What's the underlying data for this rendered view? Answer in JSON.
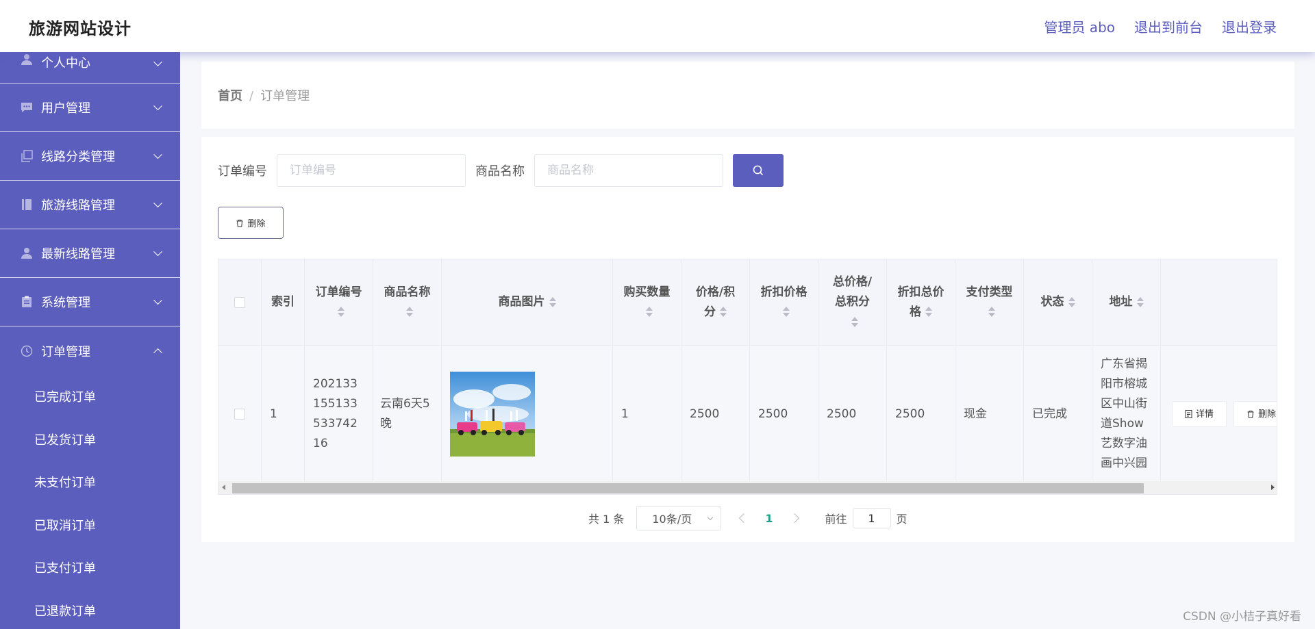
{
  "header": {
    "brand": "旅游网站设计",
    "links": [
      "管理员 abo",
      "退出到前台",
      "退出登录"
    ]
  },
  "sidebar": {
    "items": [
      {
        "label": "个人中心",
        "icon": "user-icon"
      },
      {
        "label": "用户管理",
        "icon": "chat-icon"
      },
      {
        "label": "线路分类管理",
        "icon": "copy-icon"
      },
      {
        "label": "旅游线路管理",
        "icon": "book-icon"
      },
      {
        "label": "最新线路管理",
        "icon": "user-icon"
      },
      {
        "label": "系统管理",
        "icon": "clipboard-icon"
      },
      {
        "label": "订单管理",
        "icon": "clock-icon"
      }
    ],
    "sub_items": [
      "已完成订单",
      "已发货订单",
      "未支付订单",
      "已取消订单",
      "已支付订单",
      "已退款订单"
    ]
  },
  "breadcrumb": {
    "home": "首页",
    "separator": "/",
    "current": "订单管理"
  },
  "search": {
    "order_no_label": "订单编号",
    "order_no_placeholder": "订单编号",
    "product_label": "商品名称",
    "product_placeholder": "商品名称"
  },
  "toolbar": {
    "delete_label": "删除"
  },
  "table": {
    "headers": {
      "index": "索引",
      "order_no": "订单编号",
      "product_name": "商品名称",
      "product_image": "商品图片",
      "quantity": "购买数量",
      "price": "价格/积分",
      "discount_price": "折扣价格",
      "total": "总价格/总积分",
      "discount_total": "折扣总价格",
      "pay_type": "支付类型",
      "status": "状态",
      "address": "地址"
    },
    "rows": [
      {
        "index": "1",
        "order_no": "20213315513353374216",
        "product_name": "云南6天5晚",
        "quantity": "1",
        "price": "2500",
        "discount_price": "2500",
        "total": "2500",
        "discount_total": "2500",
        "pay_type": "现金",
        "status": "已完成",
        "address": "广东省揭阳市榕城区中山街道Show艺数字油画中兴园",
        "detail_label": "详情",
        "delete_label": "删除"
      }
    ]
  },
  "pagination": {
    "total": "共 1 条",
    "page_size": "10条/页",
    "current_page": "1",
    "goto_prefix": "前往",
    "goto_value": "1",
    "goto_suffix": "页"
  },
  "watermark": "CSDN @小桔子真好看",
  "colors": {
    "primary": "#5c5ebe",
    "active_page": "#1aa18a",
    "background": "#f6f7fb"
  }
}
